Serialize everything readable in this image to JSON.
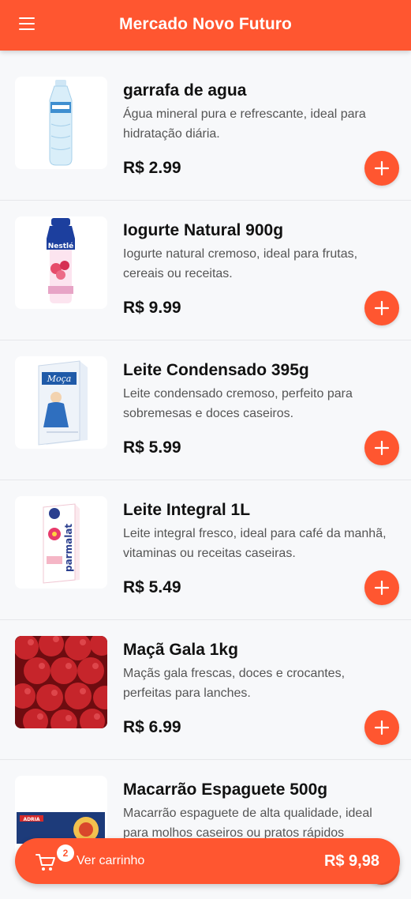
{
  "header": {
    "title": "Mercado Novo Futuro",
    "menu_icon": "hamburger-menu-icon"
  },
  "products": [
    {
      "name": "garrafa de agua",
      "description": "Água mineral pura e refrescante, ideal para hidratação diária.",
      "price": "R$ 2.99",
      "image": "water-bottle-image"
    },
    {
      "name": "Iogurte Natural 900g",
      "description": "Iogurte natural cremoso, ideal para frutas, cereais ou receitas.",
      "price": "R$ 9.99",
      "image": "yogurt-bottle-image",
      "brand_text": "Nestlé"
    },
    {
      "name": "Leite Condensado 395g",
      "description": "Leite condensado cremoso, perfeito para sobremesas e doces caseiros.",
      "price": "R$ 5.99",
      "image": "condensed-milk-box-image",
      "brand_text": "Moça"
    },
    {
      "name": "Leite Integral 1L",
      "description": "Leite integral fresco, ideal para café da manhã, vitaminas ou receitas caseiras.",
      "price": "R$ 5.49",
      "image": "milk-carton-image",
      "brand_text": "parmalat"
    },
    {
      "name": "Maçã Gala 1kg",
      "description": "Maçãs gala frescas, doces e crocantes, perfeitas para lanches.",
      "price": "R$ 6.99",
      "image": "red-apples-image"
    },
    {
      "name": "Macarrão Espaguete 500g",
      "description": "Macarrão espaguete de alta qualidade, ideal para molhos caseiros ou pratos rápidos",
      "price": "",
      "image": "spaghetti-package-image",
      "brand_text": "ADRIA"
    }
  ],
  "cart": {
    "count": "2",
    "label": "Ver carrinho",
    "total": "R$ 9,98"
  },
  "colors": {
    "accent": "#ff5630",
    "background": "#f7f8fa"
  }
}
